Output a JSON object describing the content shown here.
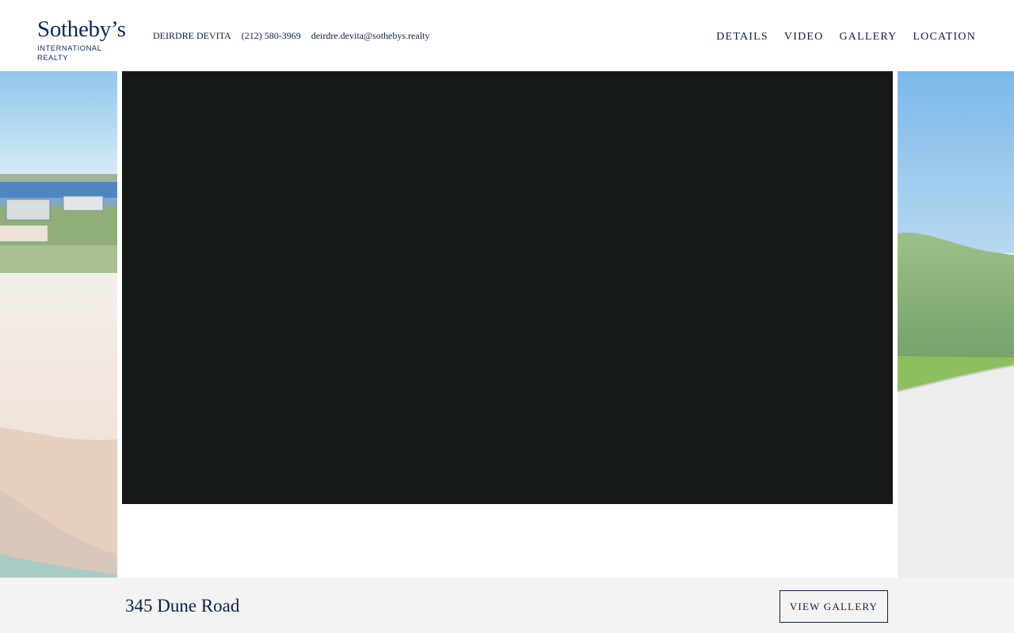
{
  "brand": {
    "logo_main": "Sotheby’s",
    "logo_sub": "INTERNATIONAL REALTY"
  },
  "agent": {
    "name": "DEIRDRE DEVITA",
    "phone": "(212) 580-3969",
    "email": "deirdre.devita@sothebys.realty"
  },
  "nav": {
    "items": [
      {
        "label": "DETAILS"
      },
      {
        "label": "VIDEO"
      },
      {
        "label": "GALLERY"
      },
      {
        "label": "LOCATION"
      }
    ]
  },
  "listing": {
    "address": "345 Dune Road",
    "view_gallery_label": "VIEW GALLERY"
  },
  "colors": {
    "brand_navy": "#0b2046",
    "video_bg": "#161a17",
    "footer_bg": "#f3f3f3"
  }
}
